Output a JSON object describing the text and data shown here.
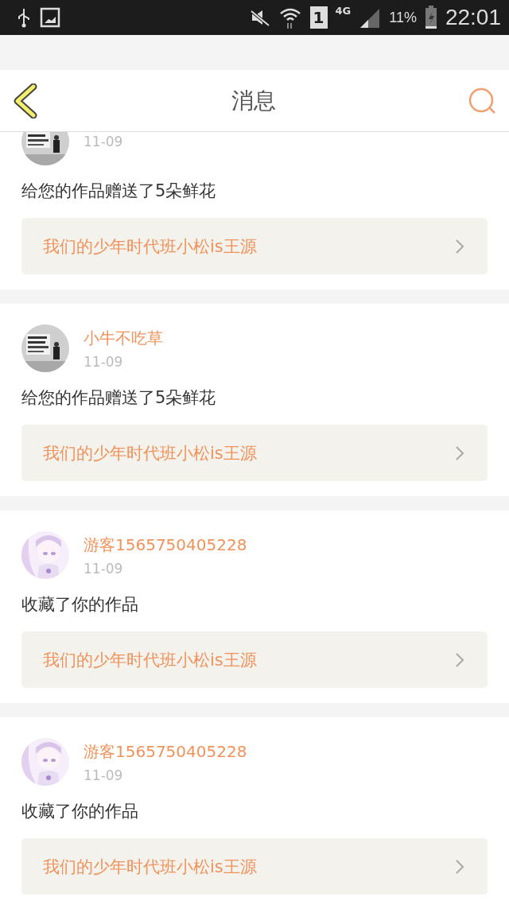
{
  "status_bar": {
    "network": "4G",
    "sim": "1",
    "battery": "11%",
    "time": "22:01"
  },
  "header": {
    "title": "消息"
  },
  "messages": [
    {
      "date": "11-09",
      "text": "给您的作品赠送了5朵鲜花",
      "work": "我们的少年时代班小松is王源"
    },
    {
      "name": "小牛不吃草",
      "date": "11-09",
      "text": "给您的作品赠送了5朵鲜花",
      "work": "我们的少年时代班小松is王源"
    },
    {
      "name": "游客1565750405228",
      "date": "11-09",
      "text": "收藏了你的作品",
      "work": "我们的少年时代班小松is王源"
    },
    {
      "name": "游客1565750405228",
      "date": "11-09",
      "text": "收藏了你的作品",
      "work": "我们的少年时代班小松is王源"
    }
  ]
}
